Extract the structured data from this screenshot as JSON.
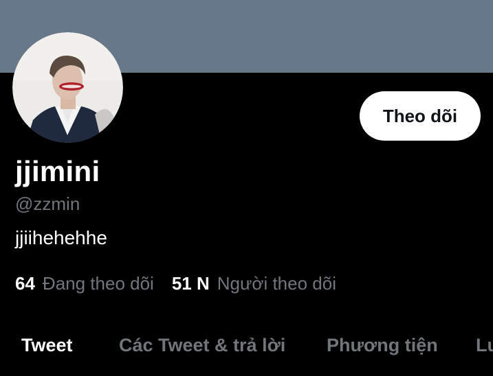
{
  "profile": {
    "display_name": "jjimini",
    "handle": "@zzmin",
    "bio": "jjiihehehhe",
    "follow_label": "Theo dõi"
  },
  "stats": {
    "following_count": "64",
    "following_label": "Đang theo dõi",
    "followers_count": "51 N",
    "followers_label": "Người theo dõi"
  },
  "tabs": [
    {
      "label": "Tweet",
      "active": true
    },
    {
      "label": "Các Tweet & trả lời",
      "active": false
    },
    {
      "label": "Phương tiện",
      "active": false
    },
    {
      "label": "Lư",
      "active": false
    }
  ],
  "colors": {
    "banner": "#66788a",
    "background": "#000000",
    "muted_text": "#71767b",
    "button_bg": "#ffffff"
  }
}
